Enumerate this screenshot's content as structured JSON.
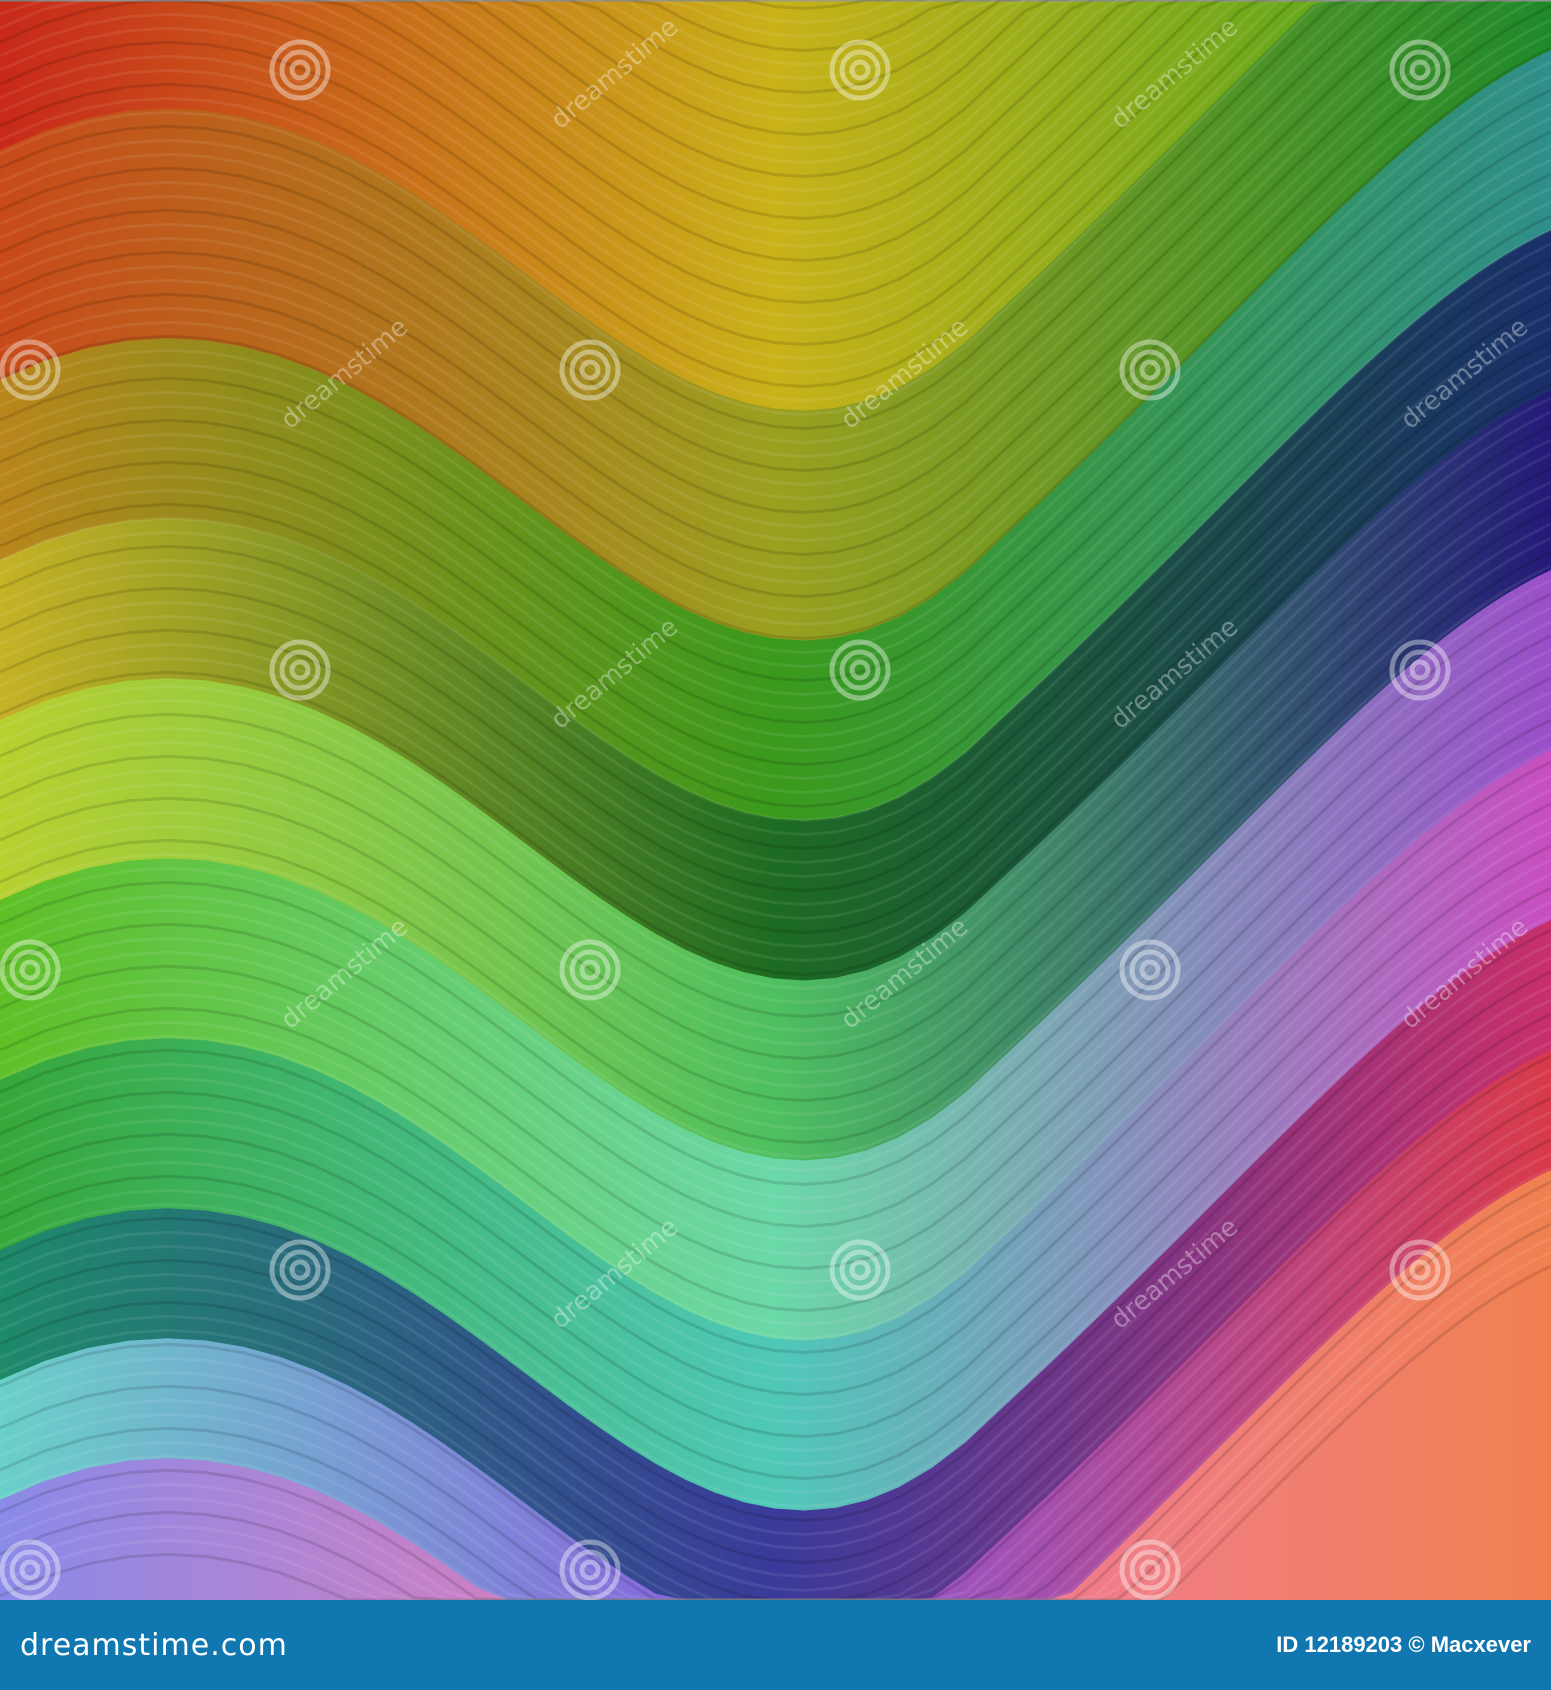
{
  "watermark": {
    "text": "dreamstime",
    "site": "dreamstime.com",
    "credit": "ID 12189203 © Macxever"
  }
}
